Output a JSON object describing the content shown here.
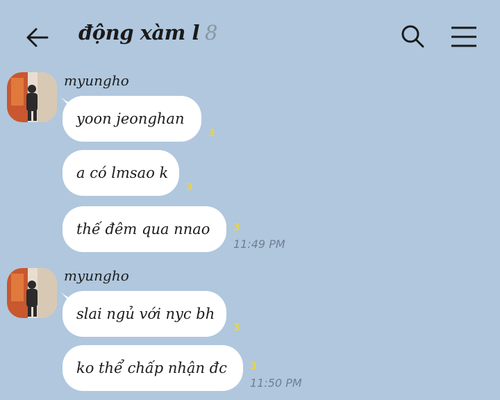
{
  "header": {
    "title": "động xàm l",
    "member_count": "8",
    "icons": [
      "back-arrow-icon",
      "search-icon",
      "menu-icon"
    ]
  },
  "groups": [
    {
      "sender": "myungho",
      "messages": [
        {
          "text": "yoon jeonghan",
          "read_count": "3"
        },
        {
          "text": "a có lmsao k",
          "read_count": "3"
        },
        {
          "text": "thế đêm qua nnao",
          "read_count": "3",
          "time": "11:49 PM"
        }
      ]
    },
    {
      "sender": "myungho",
      "messages": [
        {
          "text": "slai ngủ với nyc bh",
          "read_count": "3"
        },
        {
          "text": "ko thể chấp nhận đc",
          "read_count": "3",
          "time": "11:50 PM"
        }
      ]
    }
  ],
  "colors": {
    "background": "#b0c7de",
    "bubble": "#ffffff",
    "read_count": "#e7d44a",
    "time": "#6f7f91"
  }
}
